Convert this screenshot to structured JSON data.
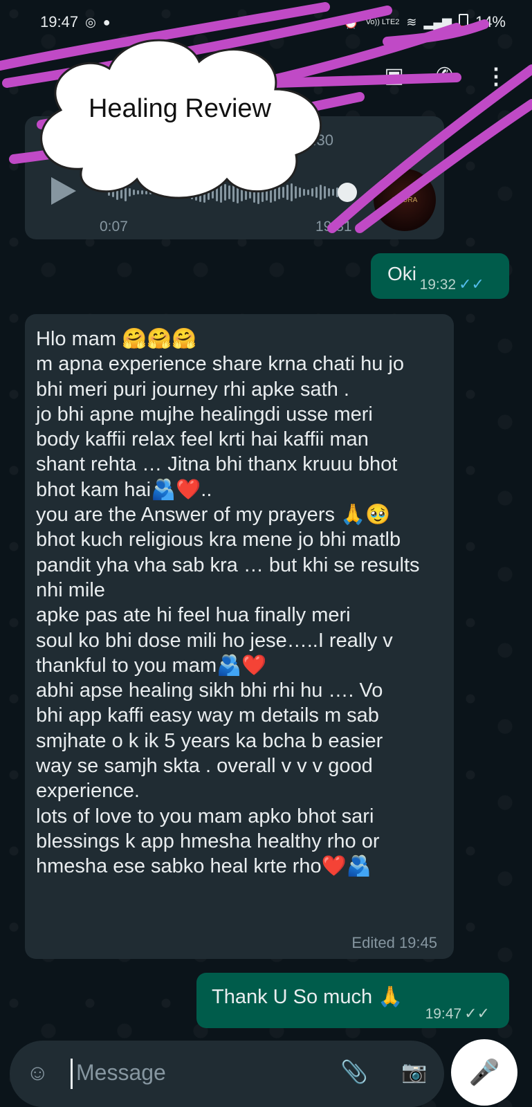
{
  "status_bar": {
    "time": "19:47",
    "left_icons": [
      "whatsapp-icon",
      "chat-icon",
      "chat-icon"
    ],
    "network_label": "Vo)) LTE2",
    "battery": "14%"
  },
  "header": {
    "icons": [
      "contact-card-icon",
      "call-icon",
      "more-options-icon"
    ]
  },
  "overlay": {
    "cloud_title": "Healing Review",
    "scribble_color": "#c04ac6"
  },
  "audio_message": {
    "top_time": ":30",
    "duration": "0:07",
    "sent_time": "19:31",
    "avatar_text": "IVAURA",
    "played_fraction": 0.92
  },
  "messages": [
    {
      "direction": "out",
      "text": "Oki",
      "time": "19:32",
      "ticks": "✓✓"
    },
    {
      "direction": "in",
      "lines": [
        "Hlo mam 🤗🤗🤗",
        "m apna experience share krna chati hu jo",
        "bhi meri puri journey rhi apke sath .",
        "jo bhi apne mujhe healingdi usse meri",
        "body kaffii relax feel krti hai kaffii man",
        "shant rehta … Jitna bhi thanx kruuu bhot",
        "bhot kam hai🫂❤️..",
        "you are the Answer of my prayers 🙏🥹",
        "bhot kuch religious kra mene jo bhi matlb",
        "pandit yha vha sab kra … but khi se results",
        "nhi mile",
        "apke pas ate hi feel hua finally meri",
        "soul ko bhi dose mili ho jese…..I really v",
        "thankful to you mam🫂❤️",
        "abhi apse healing sikh bhi rhi hu …. Vo",
        "bhi app kaffi easy way m details m sab",
        "smjhate o k ik 5 years ka bcha b easier",
        "way se samjh skta . overall v v v good",
        "experience.",
        "lots of love to you mam apko bhot sari",
        "blessings k app hmesha healthy rho or",
        "hmesha ese sabko heal krte rho❤️🫂"
      ],
      "edited_label": "Edited",
      "time": "19:45"
    },
    {
      "direction": "out",
      "text": "Thank U So much 🙏",
      "time": "19:47",
      "ticks": "✓✓"
    }
  ],
  "composer": {
    "placeholder": "Message",
    "icons": [
      "sticker-icon",
      "attach-icon",
      "camera-icon",
      "mic-icon"
    ]
  }
}
